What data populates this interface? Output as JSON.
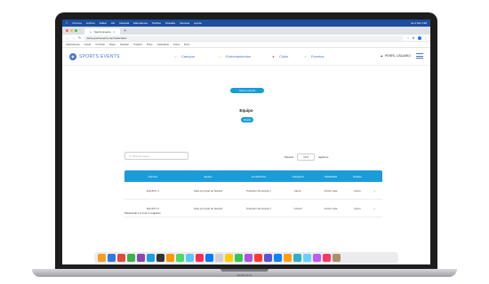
{
  "menubar": {
    "items": [
      "Chrome",
      "Archivo",
      "Editar",
      "Ver",
      "Historial",
      "Marcadores",
      "Perfiles",
      "Pestaña",
      "Ventana",
      "Ayuda"
    ],
    "clock": "vie 9 feb 3:38"
  },
  "browser": {
    "tab_title": "Sports Events",
    "url": "www.sportsevents.com/calendario",
    "bookmarks": [
      "Aplicaciones",
      "Gmail",
      "YouTube",
      "Maps",
      "Noticias",
      "Traducir",
      "Drive",
      "Calendario",
      "Fotos",
      "Docs"
    ]
  },
  "app": {
    "brand": "SPORTS EVENTS",
    "nav": [
      {
        "label": "Campus",
        "icon": "globe-icon"
      },
      {
        "label": "Entrenamientos",
        "icon": "ball-icon"
      },
      {
        "label": "Clubs",
        "icon": "people-icon"
      },
      {
        "label": "Eventos",
        "icon": "calendar-icon"
      }
    ],
    "user": "PERFIL USUARIO",
    "top_button": "Nuevo evento",
    "page_title": "Equipo",
    "add_button": "Añadir",
    "search_placeholder": "Buscar equipo",
    "filters": {
      "show_label": "Mostrar",
      "show_value": "10",
      "show_suffix": "registros"
    },
    "columns": [
      "Nombre",
      "Equipo",
      "Localización",
      "Categoría",
      "Modalidad",
      "Estado",
      ""
    ],
    "rows": [
      {
        "name": "EQUIPO 1",
        "team": "Sala principal de Madrid",
        "location": "Pabellón Municipal 1",
        "category": "Alevín",
        "mode": "Fútbol sala",
        "status": "Activo"
      },
      {
        "name": "EQUIPO 2",
        "team": "Sala principal de Madrid",
        "location": "Pabellón Municipal 2",
        "category": "Infantil",
        "mode": "Fútbol sala",
        "status": "Activo"
      }
    ],
    "footer": "Mostrando 1 a 2 de 2 registros"
  },
  "dock_colors": [
    "#f0a020",
    "#2d7be0",
    "#e04a3a",
    "#3bb24a",
    "#8e44ad",
    "#1aa0e0",
    "#333333",
    "#ff9500",
    "#4cd964",
    "#5ac8fa",
    "#ff2d55",
    "#007aff",
    "#d0d0d0",
    "#ffcc00",
    "#34c759",
    "#af52de",
    "#ff3b30",
    "#5856d6",
    "#0a84ff",
    "#ff9f0a",
    "#30b0c7",
    "#64d2ff",
    "#bf5af2",
    "#ff375f",
    "#ac8e68"
  ],
  "device_label": "MacBook Air"
}
